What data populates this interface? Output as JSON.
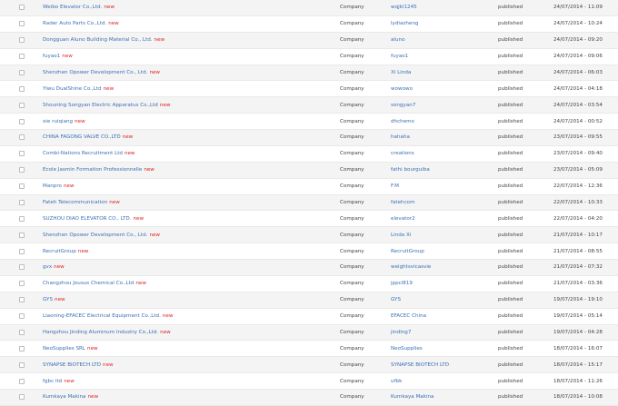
{
  "accent_link": "#3a6fb5",
  "accent_new": "#dd2222",
  "rows": [
    {
      "title": "Weibo Elevator Co.,Ltd.",
      "new": "new",
      "type": "Company",
      "author": "wqjkl1245",
      "status": "published",
      "date": "24/07/2014 - 11:09"
    },
    {
      "title": "Rader Auto Parts Co.,Ltd.",
      "new": "new",
      "type": "Company",
      "author": "lydiazheng",
      "status": "published",
      "date": "24/07/2014 - 10:24"
    },
    {
      "title": "Dongguan Aluno Building Material Co., Ltd.",
      "new": "new",
      "type": "Company",
      "author": "aluno",
      "status": "published",
      "date": "24/07/2014 - 09:20"
    },
    {
      "title": "fuyao1",
      "new": "new",
      "type": "Company",
      "author": "fuyao1",
      "status": "published",
      "date": "24/07/2014 - 09:06"
    },
    {
      "title": "Shenzhen Opower Development Co., Ltd.",
      "new": "new",
      "type": "Company",
      "author": "Xi Linda",
      "status": "published",
      "date": "24/07/2014 - 06:03"
    },
    {
      "title": "Yiwu DualShine Co.,Ltd",
      "new": "new",
      "type": "Company",
      "author": "wowowo",
      "status": "published",
      "date": "24/07/2014 - 04:18"
    },
    {
      "title": "Shouning Songyan Electric Apparatus Co.,Ltd",
      "new": "new",
      "type": "Company",
      "author": "songyan7",
      "status": "published",
      "date": "24/07/2014 - 03:54"
    },
    {
      "title": "xie ruiqiang",
      "new": "new",
      "type": "Company",
      "author": "dhchemx",
      "status": "published",
      "date": "24/07/2014 - 00:52"
    },
    {
      "title": "CHINA FAGONG VALVE CO.,LTD",
      "new": "new",
      "type": "Company",
      "author": "hahaha",
      "status": "published",
      "date": "23/07/2014 - 09:55"
    },
    {
      "title": "Combi-Nations Recruitment Ltd",
      "new": "new",
      "type": "Company",
      "author": "creations",
      "status": "published",
      "date": "23/07/2014 - 09:40"
    },
    {
      "title": "Ecole Jasmin Formation Professionnelle",
      "new": "new",
      "type": "Company",
      "author": "fathi bourguiba",
      "status": "published",
      "date": "23/07/2014 - 05:09"
    },
    {
      "title": "Manpro",
      "new": "new",
      "type": "Company",
      "author": "F.M",
      "status": "published",
      "date": "22/07/2014 - 12:36"
    },
    {
      "title": "Fateh Telecommunication",
      "new": "new",
      "type": "Company",
      "author": "fatehcom",
      "status": "published",
      "date": "22/07/2014 - 10:33"
    },
    {
      "title": "SUZHOU DIAO ELEVATOR CO., LTD.",
      "new": "new",
      "type": "Company",
      "author": "elevator2",
      "status": "published",
      "date": "22/07/2014 - 04:20"
    },
    {
      "title": "Shenzhen Opower Development Co., Ltd.",
      "new": "new",
      "type": "Company",
      "author": "Linda Xi",
      "status": "published",
      "date": "21/07/2014 - 10:17"
    },
    {
      "title": "RecruitGroup",
      "new": "new",
      "type": "Company",
      "author": "RecruitGroup",
      "status": "published",
      "date": "21/07/2014 - 08:55"
    },
    {
      "title": "gvx",
      "new": "new",
      "type": "Company",
      "author": "weightsvicasvie",
      "status": "published",
      "date": "21/07/2014 - 07:32"
    },
    {
      "title": "Changzhou Jousus Chemical Co.,Ltd",
      "new": "new",
      "type": "Company",
      "author": "jppcl819",
      "status": "published",
      "date": "21/07/2014 - 03:36"
    },
    {
      "title": "GYS",
      "new": "new",
      "type": "Company",
      "author": "GYS",
      "status": "published",
      "date": "19/07/2014 - 19:10"
    },
    {
      "title": "Liaoning-EFACEC Electrical Equipment Co.,Ltd.",
      "new": "new",
      "type": "Company",
      "author": "EFACEC China",
      "status": "published",
      "date": "19/07/2014 - 05:14"
    },
    {
      "title": "Hangzhou Jinding Aluminum Industry Co.,Ltd.",
      "new": "new",
      "type": "Company",
      "author": "jinding7",
      "status": "published",
      "date": "19/07/2014 - 04:28"
    },
    {
      "title": "NeoSupplies SRL",
      "new": "new",
      "type": "Company",
      "author": "NeoSupplies",
      "status": "published",
      "date": "18/07/2014 - 16:07"
    },
    {
      "title": "SYNAPSE BIOTECH LTD",
      "new": "new",
      "type": "Company",
      "author": "SYNAPSE BIOTECH LTD",
      "status": "published",
      "date": "18/07/2014 - 15:17"
    },
    {
      "title": "fgbc ltd",
      "new": "new",
      "type": "Company",
      "author": "ufbk",
      "status": "published",
      "date": "18/07/2014 - 11:26"
    },
    {
      "title": "Kumkaya Makina",
      "new": "new",
      "type": "Company",
      "author": "Kumkaya Makina",
      "status": "published",
      "date": "18/07/2014 - 10:08"
    }
  ]
}
